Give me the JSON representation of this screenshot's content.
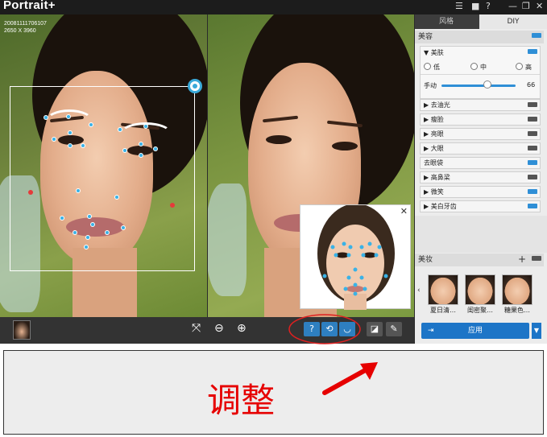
{
  "app": {
    "title": "Portrait+"
  },
  "titlebar": {
    "icons": [
      "menu-icon",
      "bookmark-icon",
      "help-icon",
      "minimize-icon",
      "restore-icon",
      "close-icon"
    ],
    "glyphs": [
      "☰",
      "■",
      "?",
      "—",
      "❐",
      "✕"
    ]
  },
  "photo_info": {
    "id": "20081111706107",
    "size": "2650 X 3960"
  },
  "toolbar": {
    "help": "?",
    "reset": "⟲",
    "face": "◡",
    "zoom_out": "⊖",
    "zoom_in": "⊕",
    "fit": "⤧",
    "eraser": "◪",
    "brush": "✎"
  },
  "panel": {
    "tabs": [
      "风格",
      "DIY"
    ],
    "beauty_section": "美容",
    "skin": {
      "label": "▼ 美肤",
      "options": [
        "低",
        "中",
        "高"
      ],
      "manual_label": "手动",
      "manual_value": "66",
      "manual_level": 0.66
    },
    "items": [
      "▶ 去油光",
      "▶ 瘦脸",
      "▶ 亮眼",
      "▶ 大眼",
      "去眼袋",
      "▶ 高鼻梁",
      "▶ 微笑",
      "▶ 美白牙齿"
    ],
    "items_on": [
      false,
      false,
      false,
      false,
      true,
      false,
      true,
      true
    ],
    "makeup_section": "美妆",
    "makeup_add": "+",
    "presets": [
      "夏日清…",
      "闺密聚…",
      "糖果色…"
    ],
    "apply_label": "应用",
    "accent_color": "#1d75c7"
  },
  "caption": {
    "text": "调整"
  }
}
